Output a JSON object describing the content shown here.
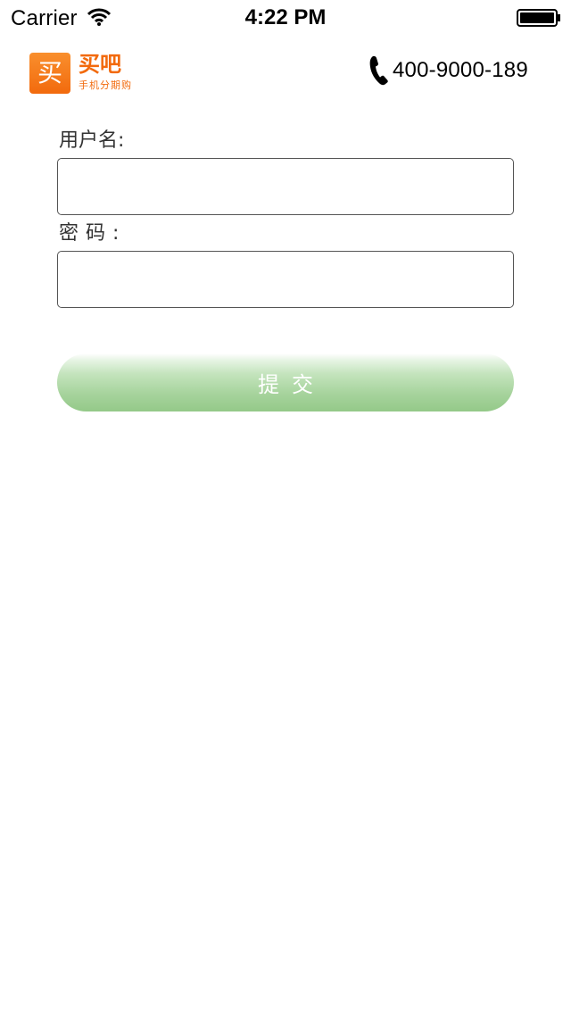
{
  "status_bar": {
    "carrier": "Carrier",
    "time": "4:22 PM",
    "icons": [
      "wifi-icon",
      "battery-icon"
    ]
  },
  "header": {
    "logo": {
      "icon_char": "买",
      "title": "买吧",
      "subtitle": "手机分期购",
      "color": "#f26a0d"
    },
    "phone_icon": "phone-icon",
    "phone_number": "400-9000-189"
  },
  "form": {
    "username_label": "用户名:",
    "username_value": "",
    "password_label": "密码:",
    "password_value": "",
    "submit_label": "提交",
    "submit_color": "#94c989"
  }
}
